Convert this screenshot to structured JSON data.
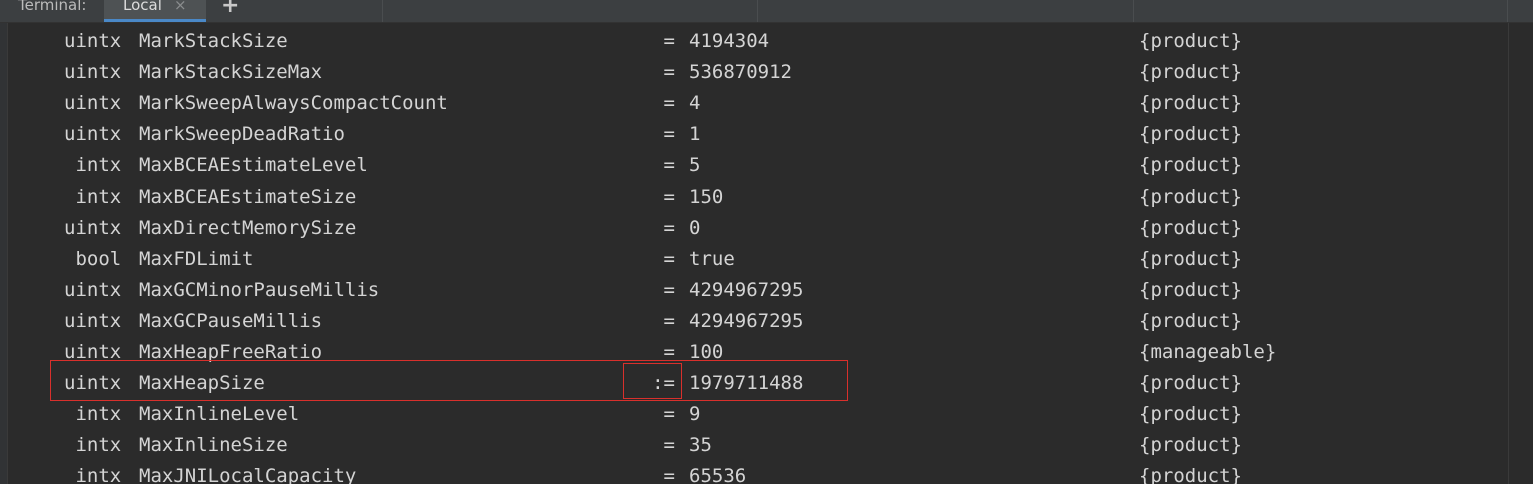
{
  "tabbar": {
    "title": "Terminal:",
    "active_tab": "Local",
    "close_glyph": "×",
    "add_glyph": "+"
  },
  "terminal": {
    "rows": [
      {
        "type": "uintx",
        "name": "MarkStackSize",
        "op": "=",
        "value": "4194304",
        "kind": "{product}"
      },
      {
        "type": "uintx",
        "name": "MarkStackSizeMax",
        "op": "=",
        "value": "536870912",
        "kind": "{product}"
      },
      {
        "type": "uintx",
        "name": "MarkSweepAlwaysCompactCount",
        "op": "=",
        "value": "4",
        "kind": "{product}"
      },
      {
        "type": "uintx",
        "name": "MarkSweepDeadRatio",
        "op": "=",
        "value": "1",
        "kind": "{product}"
      },
      {
        "type": " intx",
        "name": "MaxBCEAEstimateLevel",
        "op": "=",
        "value": "5",
        "kind": "{product}"
      },
      {
        "type": " intx",
        "name": "MaxBCEAEstimateSize",
        "op": "=",
        "value": "150",
        "kind": "{product}"
      },
      {
        "type": "uintx",
        "name": "MaxDirectMemorySize",
        "op": "=",
        "value": "0",
        "kind": "{product}"
      },
      {
        "type": " bool",
        "name": "MaxFDLimit",
        "op": "=",
        "value": "true",
        "kind": "{product}"
      },
      {
        "type": "uintx",
        "name": "MaxGCMinorPauseMillis",
        "op": "=",
        "value": "4294967295",
        "kind": "{product}"
      },
      {
        "type": "uintx",
        "name": "MaxGCPauseMillis",
        "op": "=",
        "value": "4294967295",
        "kind": "{product}"
      },
      {
        "type": "uintx",
        "name": "MaxHeapFreeRatio",
        "op": "=",
        "value": "100",
        "kind": "{manageable}"
      },
      {
        "type": "uintx",
        "name": "MaxHeapSize",
        "op": ":=",
        "value": "1979711488",
        "kind": "{product}"
      },
      {
        "type": " intx",
        "name": "MaxInlineLevel",
        "op": "=",
        "value": "9",
        "kind": "{product}"
      },
      {
        "type": " intx",
        "name": "MaxInlineSize",
        "op": "=",
        "value": "35",
        "kind": "{product}"
      },
      {
        "type": " intx",
        "name": "MaxJNILocalCapacity",
        "op": "=",
        "value": "65536",
        "kind": "{product}"
      }
    ]
  },
  "colors": {
    "background": "#2b2b2b",
    "text": "#d4d4d4",
    "highlight_border": "#d9302c",
    "active_tab_underline": "#4a88c7"
  }
}
